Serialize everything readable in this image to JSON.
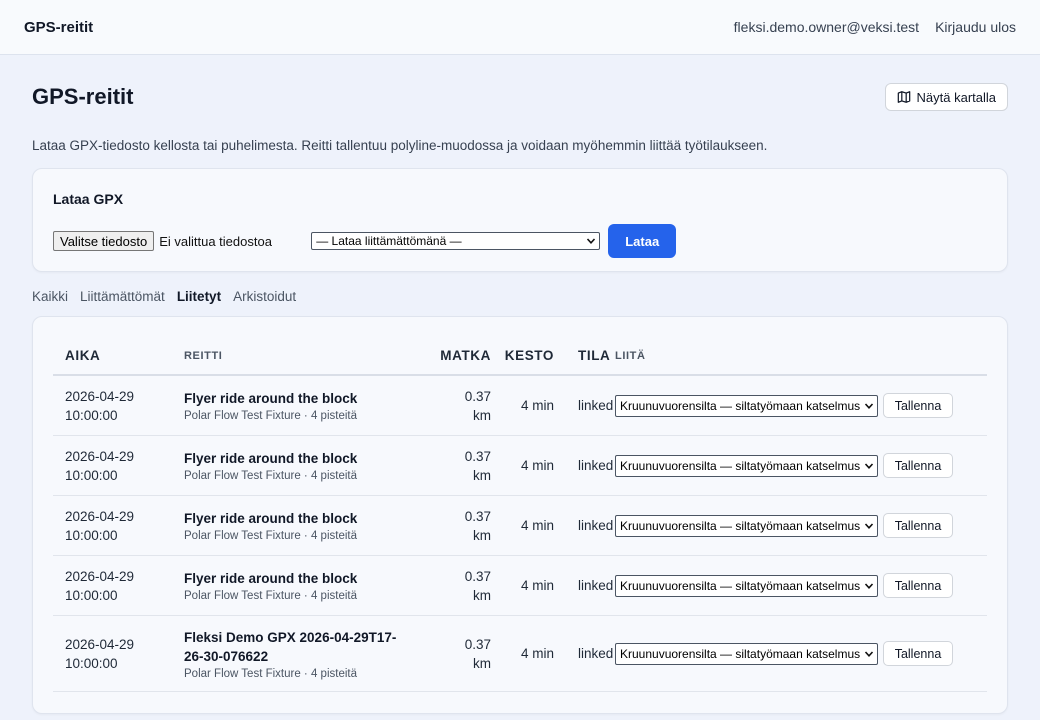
{
  "header": {
    "brand": "GPS-reitit",
    "user_email": "fleksi.demo.owner@veksi.test",
    "logout_label": "Kirjaudu ulos"
  },
  "page": {
    "title": "GPS-reitit",
    "map_button_label": "Näytä kartalla",
    "description": "Lataa GPX-tiedosto kellosta tai puhelimesta. Reitti tallentuu polyline-muodossa ja voidaan myöhemmin liittää työtilaukseen."
  },
  "upload": {
    "title": "Lataa GPX",
    "file_button_label": "Valitse tiedosto",
    "file_status": "Ei valittua tiedostoa",
    "select_value": "— Lataa liittämättömänä —",
    "submit_label": "Lataa"
  },
  "tabs": [
    {
      "label": "Kaikki",
      "active": false
    },
    {
      "label": "Liittämättömät",
      "active": false
    },
    {
      "label": "Liitetyt",
      "active": true
    },
    {
      "label": "Arkistoidut",
      "active": false
    }
  ],
  "table": {
    "headers": {
      "time": "AIKA",
      "route": "REITTI",
      "distance": "MATKA",
      "duration": "KESTO",
      "status": "TILA",
      "link": "LIITÄ"
    },
    "rows": [
      {
        "date": "2026-04-29",
        "time": "10:00:00",
        "name": "Flyer ride around the block",
        "meta": "Polar Flow Test Fixture · 4 pisteitä",
        "distance": "0.37",
        "distance_unit": "km",
        "duration": "4 min",
        "status": "linked",
        "link_value": "Kruunuvuorensilta — siltatyömaan katselmus",
        "save_label": "Tallenna"
      },
      {
        "date": "2026-04-29",
        "time": "10:00:00",
        "name": "Flyer ride around the block",
        "meta": "Polar Flow Test Fixture · 4 pisteitä",
        "distance": "0.37",
        "distance_unit": "km",
        "duration": "4 min",
        "status": "linked",
        "link_value": "Kruunuvuorensilta — siltatyömaan katselmus",
        "save_label": "Tallenna"
      },
      {
        "date": "2026-04-29",
        "time": "10:00:00",
        "name": "Flyer ride around the block",
        "meta": "Polar Flow Test Fixture · 4 pisteitä",
        "distance": "0.37",
        "distance_unit": "km",
        "duration": "4 min",
        "status": "linked",
        "link_value": "Kruunuvuorensilta — siltatyömaan katselmus",
        "save_label": "Tallenna"
      },
      {
        "date": "2026-04-29",
        "time": "10:00:00",
        "name": "Flyer ride around the block",
        "meta": "Polar Flow Test Fixture · 4 pisteitä",
        "distance": "0.37",
        "distance_unit": "km",
        "duration": "4 min",
        "status": "linked",
        "link_value": "Kruunuvuorensilta — siltatyömaan katselmus",
        "save_label": "Tallenna"
      },
      {
        "date": "2026-04-29",
        "time": "10:00:00",
        "name": "Fleksi Demo GPX 2026-04-29T17-26-30-076622",
        "meta": "Polar Flow Test Fixture · 4 pisteitä",
        "distance": "0.37",
        "distance_unit": "km",
        "duration": "4 min",
        "status": "linked",
        "link_value": "Kruunuvuorensilta — siltatyömaan katselmus",
        "save_label": "Tallenna"
      }
    ]
  },
  "icons": {
    "map": "map-icon",
    "select_arrow": "chevron-down-icon"
  }
}
